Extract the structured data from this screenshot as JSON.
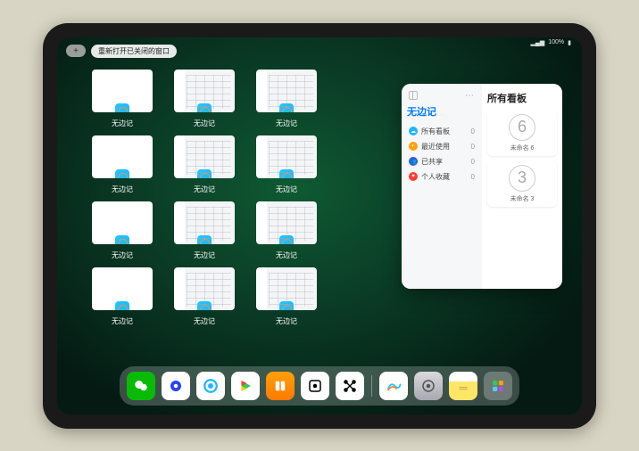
{
  "statusbar": {
    "signal": "◦◦◦",
    "battery": "100%"
  },
  "toolbar": {
    "plus": "+",
    "reopen_label": "重新打开已关闭的窗口"
  },
  "app_label": "无边记",
  "windows": [
    {
      "style": "blank"
    },
    {
      "style": "cal"
    },
    {
      "style": "cal"
    },
    {
      "style": "blank"
    },
    {
      "style": "cal"
    },
    {
      "style": "cal"
    },
    {
      "style": "blank"
    },
    {
      "style": "cal"
    },
    {
      "style": "cal"
    },
    {
      "style": "blank"
    },
    {
      "style": "cal"
    },
    {
      "style": "cal"
    }
  ],
  "grid_skip_index": 3,
  "panel": {
    "title": "无边记",
    "right_title": "所有看板",
    "rows": [
      {
        "icon": "blue",
        "glyph": "☁",
        "label": "所有看板",
        "count": 0
      },
      {
        "icon": "ora",
        "glyph": "◐",
        "label": "最近使用",
        "count": 0
      },
      {
        "icon": "nav",
        "glyph": "👥",
        "label": "已共享",
        "count": 0
      },
      {
        "icon": "red",
        "glyph": "♥",
        "label": "个人收藏",
        "count": 0
      }
    ],
    "boards": [
      {
        "glyph": "6",
        "caption": "未命名 6"
      },
      {
        "glyph": "3",
        "caption": "未命名 3"
      }
    ]
  },
  "dock": [
    {
      "name": "wechat-icon",
      "bg": "#09bb07",
      "svg": "wechat"
    },
    {
      "name": "quark-icon",
      "bg": "#ffffff",
      "svg": "quark"
    },
    {
      "name": "qqbrowser-icon",
      "bg": "#ffffff",
      "svg": "qqbrowser"
    },
    {
      "name": "play-icon",
      "bg": "#ffffff",
      "svg": "play"
    },
    {
      "name": "books-icon",
      "bg": "linear-gradient(#ff9f0a,#ff7a00)",
      "svg": "books"
    },
    {
      "name": "dice-icon",
      "bg": "#ffffff",
      "svg": "dot"
    },
    {
      "name": "connect-icon",
      "bg": "#ffffff",
      "svg": "oxo"
    },
    {
      "name": "freeform-icon",
      "bg": "#ffffff",
      "svg": "freeform"
    },
    {
      "name": "settings-icon",
      "bg": "linear-gradient(#d9d9de,#a8a8b0)",
      "svg": "gear"
    },
    {
      "name": "notes-icon",
      "bg": "linear-gradient(#fff 35%,#ffe666 35%)",
      "svg": "notes"
    },
    {
      "name": "applibrary-icon",
      "bg": "rgba(255,255,255,.25)",
      "svg": "grid4"
    }
  ]
}
